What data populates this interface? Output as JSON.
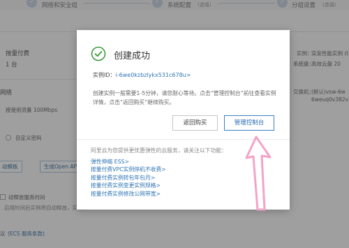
{
  "stepper": {
    "steps": [
      {
        "label": "网络和安全组",
        "sub": ""
      },
      {
        "label": "系统配置",
        "sub": "(选填)"
      },
      {
        "label": "分组设置",
        "sub": "(选填)"
      }
    ]
  },
  "background": {
    "billing_label": "按量付费",
    "count_value": "1 台",
    "network_label": "网络",
    "bandwidth_label": "按使用流量 100Mbps",
    "custom_image_label": "自定义密码",
    "template_button": "动模板",
    "openapi_button": "生成Open API",
    "auto_release_label": "动释放服务时间",
    "auto_release_desc": "启用时间后实例将自动释放，实例释",
    "agreement_text": "(ECS 服务条款)",
    "agreement_prefix": "议",
    "right_instance_label": "实例：",
    "right_instance_value": "突发性能实例 (t",
    "right_disk_label": "系统盘：",
    "right_disk_value": "高效云盘 20",
    "right_switch_label": "交换机：",
    "right_switch_value_1": "(默认)vsw-6w",
    "right_switch_value_2": "6weuq0v382v"
  },
  "modal": {
    "title": "创建成功",
    "instance_label": "实例ID：",
    "instance_id": "i-6we0kzbzlykx531c678u>",
    "description": "创建实例一般需要1-5分钟，请您耐心等待。点击“管理控制台”前往查看实例详情，点击“返回购买”继续购买。",
    "back_button": "返回购买",
    "console_button": "管理控制台",
    "extra_title": "阿里云为您提供更优惠弹性的云服务，请关注以下功能：",
    "extra_links": [
      "弹性伸缩 ESS>",
      "按量付费VPC实例停机不收费>",
      "按量付费实例转包年包月>",
      "按量付费实例变更实例规格>",
      "按量付费实例修改公网带宽>"
    ]
  },
  "colors": {
    "success_green": "#3a9a3a",
    "link_blue": "#2f75b5",
    "primary_border": "#3880c4",
    "annotation_pink": "#f4a3c8"
  }
}
